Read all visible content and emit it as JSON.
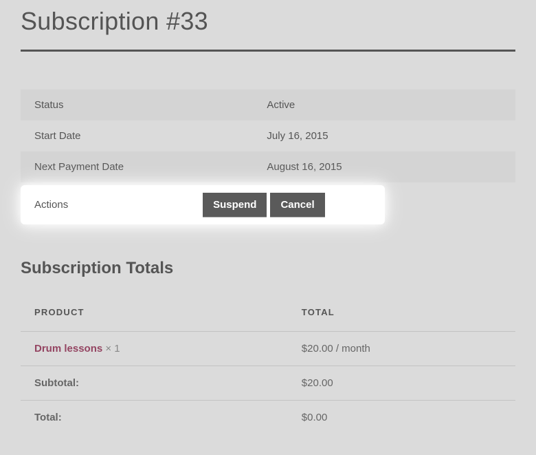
{
  "page": {
    "title": "Subscription #33"
  },
  "details": {
    "status_label": "Status",
    "status_value": "Active",
    "start_label": "Start Date",
    "start_value": "July 16, 2015",
    "next_label": "Next Payment Date",
    "next_value": "August 16, 2015",
    "actions_label": "Actions"
  },
  "actions": {
    "suspend": "Suspend",
    "cancel": "Cancel"
  },
  "totals_section": {
    "heading": "Subscription Totals",
    "product_header": "PRODUCT",
    "total_header": "TOTAL"
  },
  "items": [
    {
      "name": "Drum lessons",
      "qty_display": " × 1",
      "total": "$20.00 / month"
    }
  ],
  "subtotal": {
    "label": "Subtotal:",
    "value": "$20.00"
  },
  "total": {
    "label": "Total:",
    "value": "$0.00"
  }
}
